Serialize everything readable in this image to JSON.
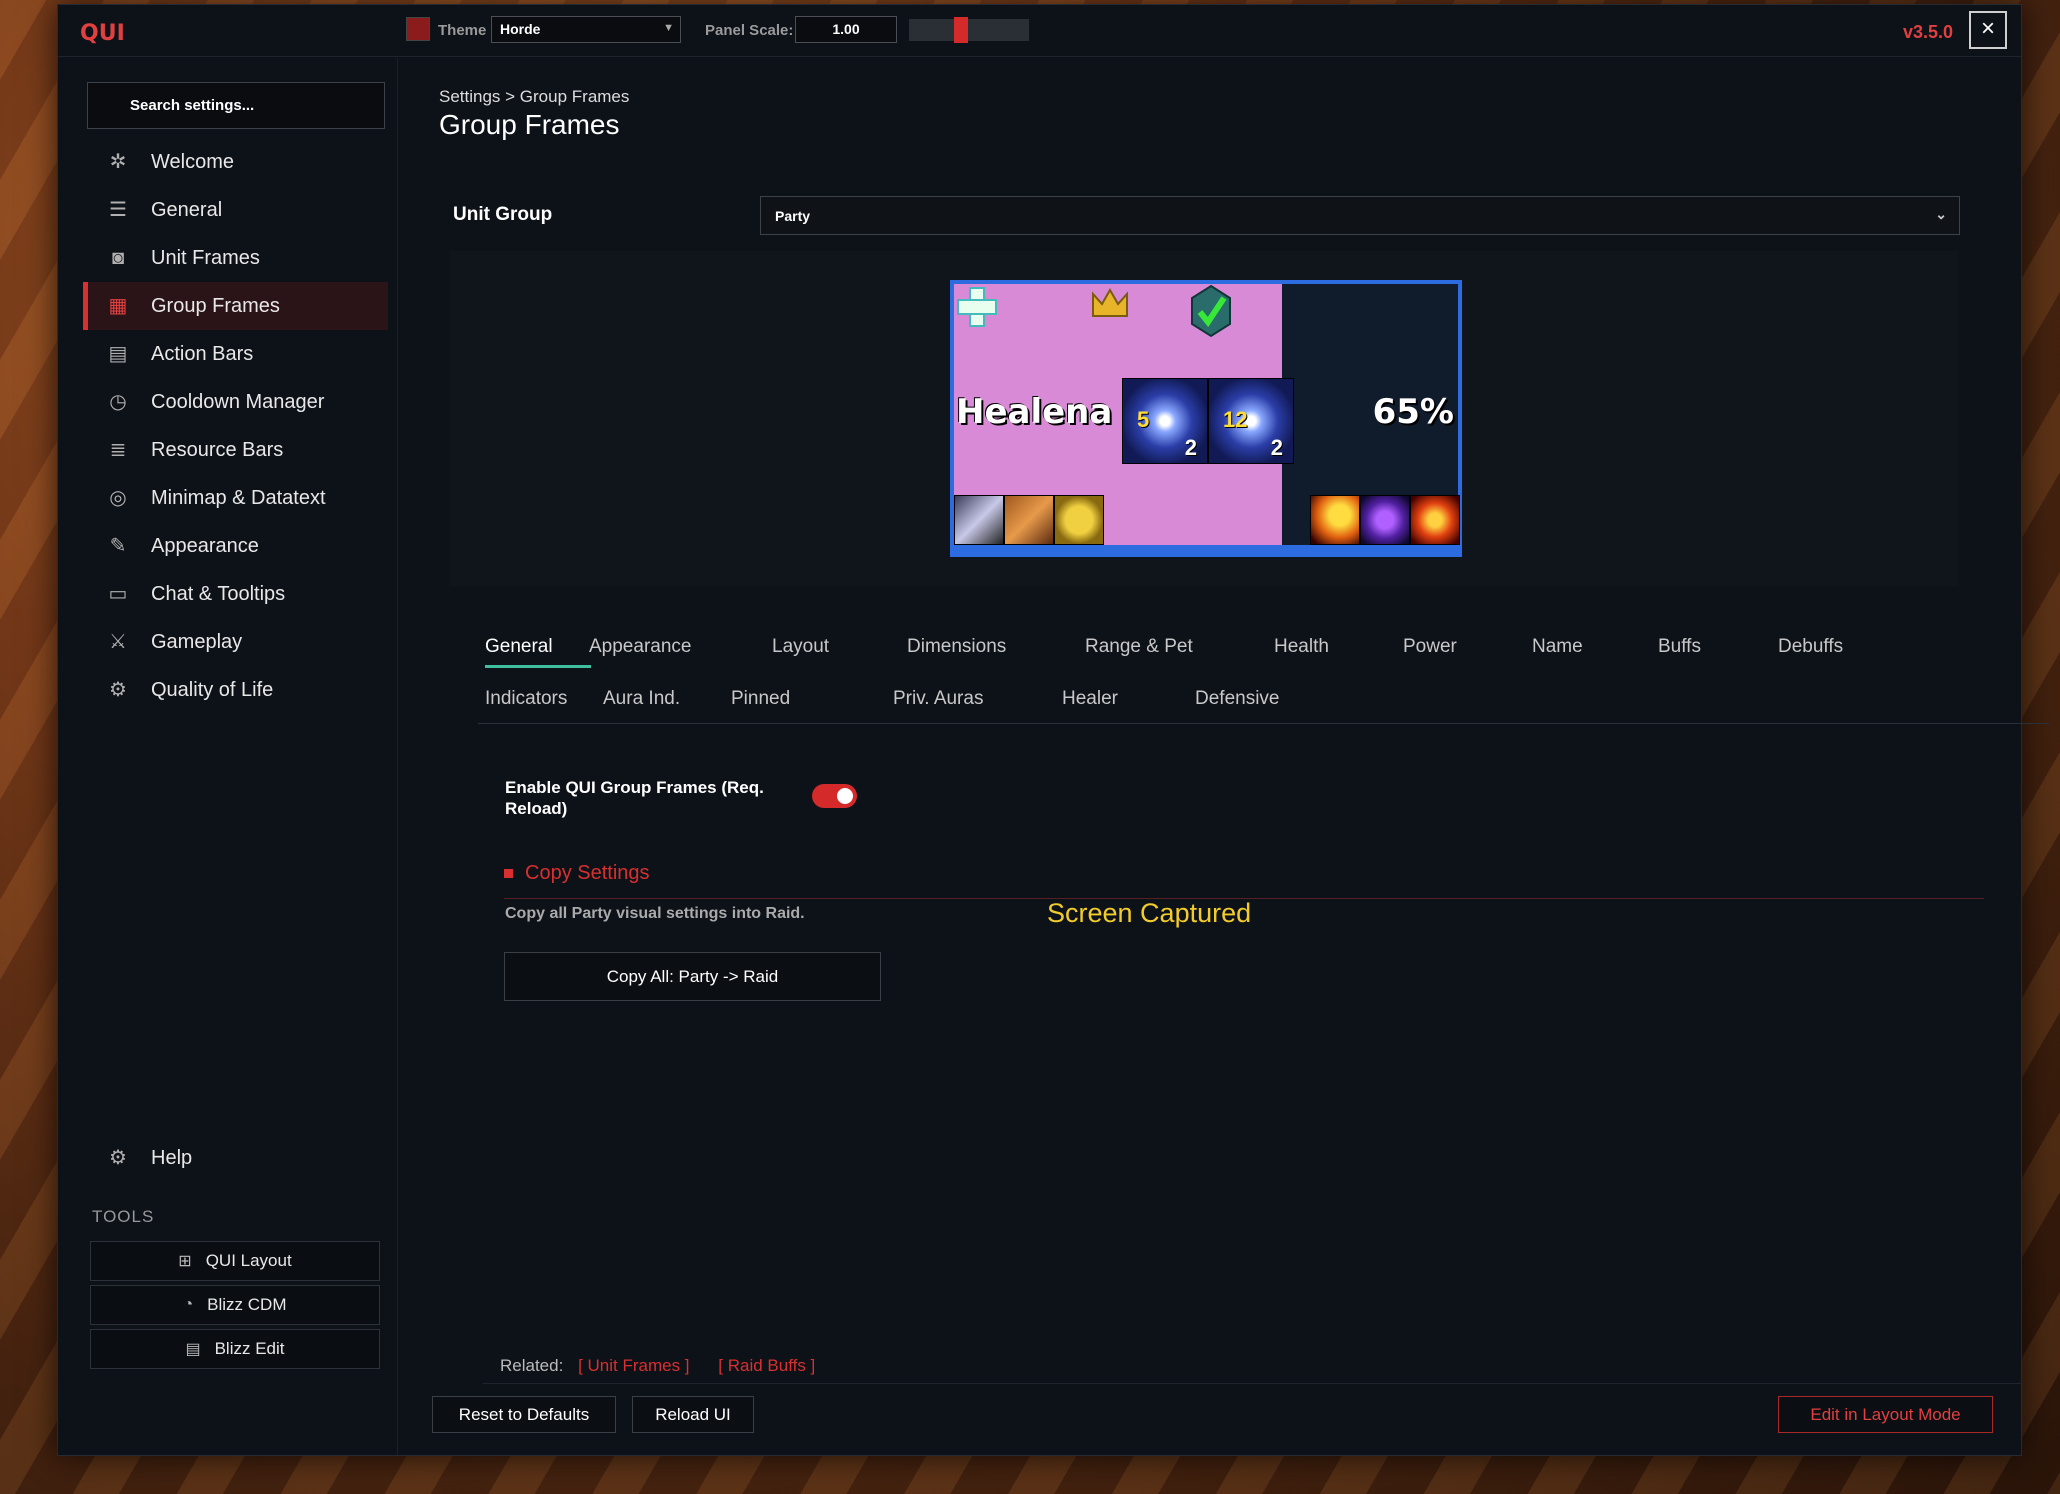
{
  "titlebar": {
    "logo": "QUI",
    "theme_label": "Theme",
    "theme_value": "Horde",
    "theme_color": "#8b1c1c",
    "scale_label": "Panel Scale:",
    "scale_value": "1.00",
    "version": "v3.5.0",
    "close_icon": "×"
  },
  "sidebar": {
    "search_placeholder": "Search settings...",
    "items": [
      {
        "label": "Welcome",
        "icon": "compass-icon",
        "glyph": "✲"
      },
      {
        "label": "General",
        "icon": "sliders-icon",
        "glyph": "☰"
      },
      {
        "label": "Unit Frames",
        "icon": "user-frame-icon",
        "glyph": "◙"
      },
      {
        "label": "Group Frames",
        "icon": "group-frames-icon",
        "glyph": "▦"
      },
      {
        "label": "Action Bars",
        "icon": "action-bars-icon",
        "glyph": "▤"
      },
      {
        "label": "Cooldown Manager",
        "icon": "clock-icon",
        "glyph": "◷"
      },
      {
        "label": "Resource Bars",
        "icon": "bars-icon",
        "glyph": "≣"
      },
      {
        "label": "Minimap & Datatext",
        "icon": "minimap-icon",
        "glyph": "◎"
      },
      {
        "label": "Appearance",
        "icon": "brush-icon",
        "glyph": "✎"
      },
      {
        "label": "Chat & Tooltips",
        "icon": "chat-icon",
        "glyph": "▭"
      },
      {
        "label": "Gameplay",
        "icon": "swords-icon",
        "glyph": "⚔"
      },
      {
        "label": "Quality of Life",
        "icon": "gear-icon",
        "glyph": "⚙"
      }
    ],
    "help": "Help",
    "tools_label": "TOOLS",
    "tools": [
      {
        "label": "QUI Layout",
        "icon": "layout-icon",
        "glyph": "⊞"
      },
      {
        "label": "Blizz CDM",
        "icon": "cdm-icon",
        "glyph": "◔"
      },
      {
        "label": "Blizz Edit",
        "icon": "edit-icon",
        "glyph": "▤"
      }
    ]
  },
  "main": {
    "breadcrumb": "Settings  >  Group Frames",
    "title": "Group Frames",
    "unit_group_label": "Unit Group",
    "unit_group_value": "Party",
    "preview": {
      "name": "Healena",
      "health_percent": "65%",
      "auras": [
        {
          "count": "5",
          "stacks": "2"
        },
        {
          "count": "12",
          "stacks": "2"
        }
      ]
    },
    "tabs_row1": [
      "General",
      "Appearance",
      "Layout",
      "Dimensions",
      "Range & Pet",
      "Health",
      "Power",
      "Name",
      "Buffs",
      "Debuffs"
    ],
    "tabs_row2": [
      "Indicators",
      "Aura Ind.",
      "Pinned",
      "Priv. Auras",
      "Healer",
      "Defensive"
    ],
    "enable_label": "Enable QUI Group Frames (Req. Reload)",
    "copy_section": "Copy Settings",
    "copy_desc": "Copy all Party visual settings into Raid.",
    "copy_button": "Copy All: Party -> Raid",
    "captured": "Screen Captured",
    "related_label": "Related:",
    "related_links": [
      "[ Unit Frames ]",
      "[ Raid Buffs ]"
    ],
    "reset_button": "Reset to Defaults",
    "reload_button": "Reload UI",
    "layout_button": "Edit in Layout Mode"
  }
}
